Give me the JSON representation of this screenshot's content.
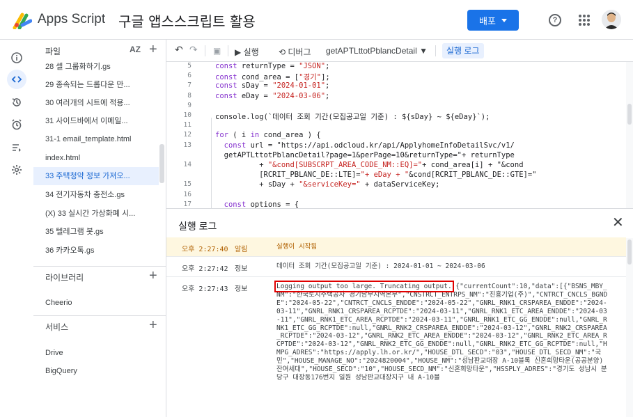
{
  "header": {
    "app_name": "Apps Script",
    "project_title": "구글 앱스스크립트 활용",
    "deploy_label": "배포",
    "help_glyph": "?"
  },
  "files": {
    "header_label": "파일",
    "sort_label": "AZ",
    "items": [
      "28 셀 그룹화하기.gs",
      "29 종속되는 드롭다운 만...",
      "30 여러개의 시트에 적용...",
      "31 사이드바에서 이메일...",
      "31-1 email_template.html",
      "index.html",
      "33 주택청약 정보 가져오...",
      "34 전기자동차 충전소.gs",
      "(X) 33 실시간 가상화폐 시...",
      "35 텔레그램 봇.gs",
      "36 카카오톡.gs"
    ],
    "libraries_label": "라이브러리",
    "library_items": [
      "Cheerio"
    ],
    "services_label": "서비스",
    "service_items": [
      "Drive",
      "BigQuery"
    ]
  },
  "toolbar": {
    "undo": "↶",
    "redo": "↷",
    "save": "▣",
    "run_label": "▶ 실행",
    "debug_label": "⟲ 디버그",
    "function_name": "getAPTLttotPblancDetail ▼",
    "log_label": "실행 로그"
  },
  "code": {
    "lines": [
      {
        "n": "5",
        "t": "const returnType = \"JSON\";"
      },
      {
        "n": "6",
        "t": "const cond_area = [\"경기\"];"
      },
      {
        "n": "7",
        "t": "const sDay = \"2024-01-01\";"
      },
      {
        "n": "8",
        "t": "const eDay = \"2024-03-06\";"
      },
      {
        "n": "9",
        "t": ""
      },
      {
        "n": "10",
        "t": "console.log(`데이터 조회 기간(모집공고일 기준) : ${sDay} ~ ${eDay}`);"
      },
      {
        "n": "11",
        "t": ""
      },
      {
        "n": "12",
        "t": "for ( i in cond_area ) {"
      },
      {
        "n": "13",
        "t": "  const url = \"https://api.odcloud.kr/api/ApplyhomeInfoDetailSvc/v1/"
      },
      {
        "n": "",
        "t": "  getAPTLttotPblancDetail?page=1&perPage=10&returnType=\"+ returnType"
      },
      {
        "n": "14",
        "t": "          + \"&cond[SUBSCRPT_AREA_CODE_NM::EQ]=\"+ cond_area[i] + \"&cond"
      },
      {
        "n": "",
        "t": "          [RCRIT_PBLANC_DE::LTE]=\"+ eDay + \"&cond[RCRIT_PBLANC_DE::GTE]=\""
      },
      {
        "n": "15",
        "t": "          + sDay + \"&serviceKey=\" + dataServiceKey;"
      },
      {
        "n": "16",
        "t": ""
      },
      {
        "n": "17",
        "t": "  const options = {"
      }
    ]
  },
  "log": {
    "title": "실행 로그",
    "close_glyph": "✕",
    "rows": [
      {
        "time": "오후 2:27:40",
        "level": "알림",
        "msg": "실행이 시작됨"
      },
      {
        "time": "오후 2:27:42",
        "level": "정보",
        "msg": "데이터 조회 기간(모집공고일 기준) : 2024-01-01 ~ 2024-03-06"
      },
      {
        "time": "오후 2:27:43",
        "level": "정보",
        "msg_highlight": "Logging output too large. Truncating output.",
        "msg": " {\"currentCount\":10,\"data\":[{\"BSNS_MBY_NM\":\"한국토지주택공사 경기남부지역본부\",\"CNSTRCT_ENTRPS_NM\":\"진흥기업(주)\",\"CNTRCT_CNCLS_BGNDE\":\"2024-05-22\",\"CNTRCT_CNCLS_ENDDE\":\"2024-05-22\",\"GNRL_RNK1_CRSPAREA_ENDDE\":\"2024-03-11\",\"GNRL_RNK1_CRSPAREA_RCPTDE\":\"2024-03-11\",\"GNRL_RNK1_ETC_AREA_ENDDE\":\"2024-03-11\",\"GNRL_RNK1_ETC_AREA_RCPTDE\":\"2024-03-11\",\"GNRL_RNK1_ETC_GG_ENDDE\":null,\"GNRL_RNK1_ETC_GG_RCPTDE\":null,\"GNRL_RNK2_CRSPAREA_ENDDE\":\"2024-03-12\",\"GNRL_RNK2_CRSPAREA_RCPTDE\":\"2024-03-12\",\"GNRL_RNK2_ETC_AREA_ENDDE\":\"2024-03-12\",\"GNRL_RNK2_ETC_AREA_RCPTDE\":\"2024-03-12\",\"GNRL_RNK2_ETC_GG_ENDDE\":null,\"GNRL_RNK2_ETC_GG_RCPTDE\":null,\"HMPG_ADRES\":\"https://apply.lh.or.kr/\",\"HOUSE_DTL_SECD\":\"03\",\"HOUSE_DTL_SECD_NM\":\"국민\",\"HOUSE_MANAGE_NO\":\"2024820004\",\"HOUSE_NM\":\"성남판교대장 A-10블록 신혼희망타운(공공분양) 잔여세대\",\"HOUSE_SECD\":\"10\",\"HOUSE_SECD_NM\":\"신혼희망타운\",\"HSSPLY_ADRES\":\"경기도 성남시 분당구 대장동176번지 일원 성남판교대장지구 내 A-10블"
      }
    ]
  },
  "colors": {
    "accent": "#1a73e8",
    "warn_bg": "#fef7e0",
    "highlight_border": "#e00000"
  }
}
